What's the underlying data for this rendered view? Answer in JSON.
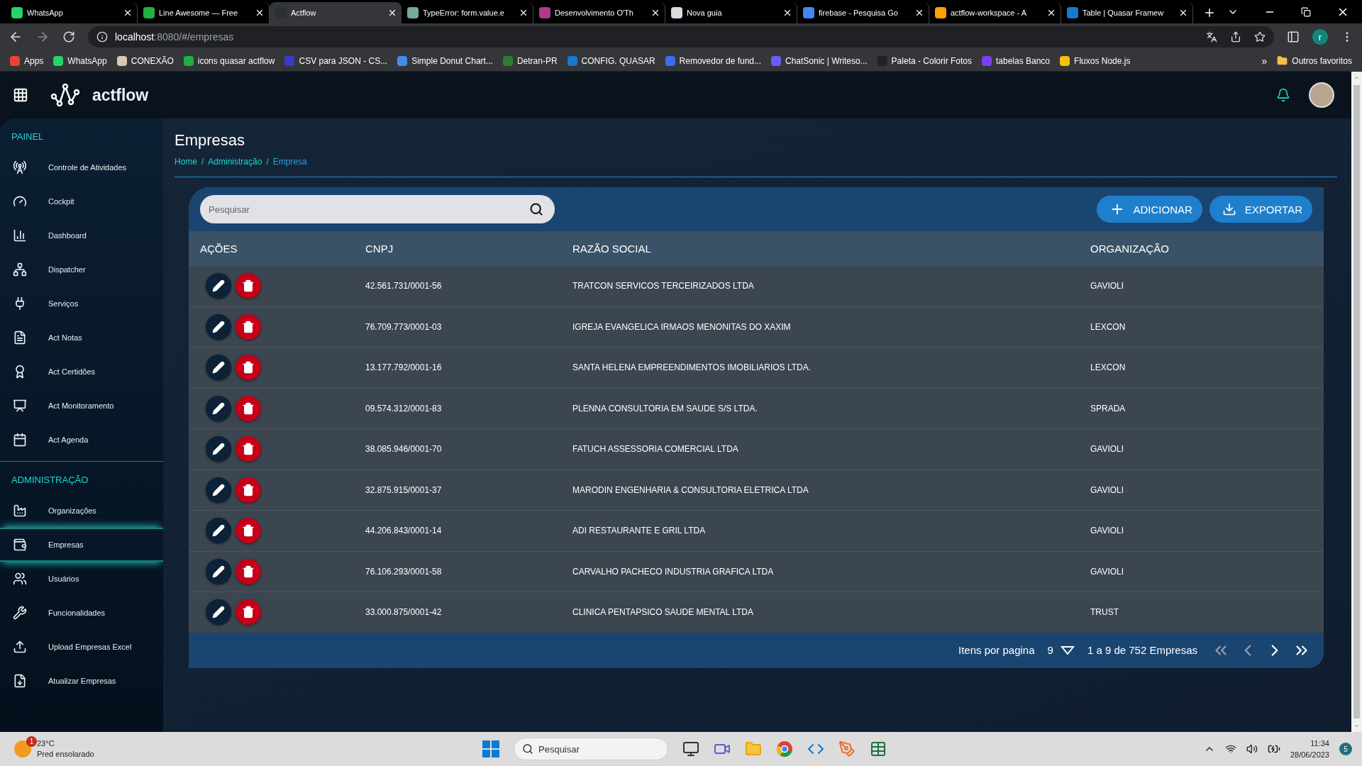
{
  "browser": {
    "tabs": [
      {
        "title": "WhatsApp",
        "selected": false,
        "color": "#25d366"
      },
      {
        "title": "Line Awesome — Free",
        "selected": false,
        "color": "#1fb141"
      },
      {
        "title": "Actflow",
        "selected": true,
        "color": "#2b2f36"
      },
      {
        "title": "TypeError: form.value.e",
        "selected": false,
        "color": "#74aa9c"
      },
      {
        "title": "Desenvolvimento O'Th",
        "selected": false,
        "color": "#b03a8c"
      },
      {
        "title": "Nova guia",
        "selected": false,
        "color": "#dadce0"
      },
      {
        "title": "firebase - Pesquisa Go",
        "selected": false,
        "color": "#4285f4"
      },
      {
        "title": "actflow-workspace - A",
        "selected": false,
        "color": "#ffa000"
      },
      {
        "title": "Table | Quasar Framew",
        "selected": false,
        "color": "#1976d2"
      }
    ],
    "address": {
      "host": "localhost",
      "path": ":8080/#/empresas"
    },
    "bookmarks": [
      {
        "label": "Apps",
        "color": "#ea4335"
      },
      {
        "label": "WhatsApp",
        "color": "#25d366"
      },
      {
        "label": "CONEXÃO",
        "color": "#d9c7b0"
      },
      {
        "label": "icons quasar actflow",
        "color": "#1fb141"
      },
      {
        "label": "CSV para JSON - CS...",
        "color": "#3a3ad0"
      },
      {
        "label": "Simple Donut Chart...",
        "color": "#3f8ef0"
      },
      {
        "label": "Detran-PR",
        "color": "#2e7d32"
      },
      {
        "label": "CONFIG. QUASAR",
        "color": "#1976d2"
      },
      {
        "label": "Removedor de fund...",
        "color": "#3b6df2"
      },
      {
        "label": "ChatSonic | Writeso...",
        "color": "#6b5cff"
      },
      {
        "label": "Paleta - Colorir Fotos",
        "color": "#222222"
      },
      {
        "label": "tabelas Banco",
        "color": "#7e3ff2"
      },
      {
        "label": "Fluxos Node.js",
        "color": "#f5c400"
      }
    ],
    "more_bookmarks": "»",
    "other_bookmarks": "Outros favoritos",
    "profile_initial": "r"
  },
  "app": {
    "brand": "actflow",
    "sidebar": [
      {
        "title": "PAINEL",
        "items": [
          {
            "label": "Controle de Atividades",
            "selected": false
          },
          {
            "label": "Cockpit",
            "selected": false
          },
          {
            "label": "Dashboard",
            "selected": false
          },
          {
            "label": "Dispatcher",
            "selected": false
          },
          {
            "label": "Serviços",
            "selected": false
          },
          {
            "label": "Act Notas",
            "selected": false
          },
          {
            "label": "Act Certidões",
            "selected": false
          },
          {
            "label": "Act Monitoramento",
            "selected": false
          },
          {
            "label": "Act Agenda",
            "selected": false
          }
        ]
      },
      {
        "title": "ADMINISTRAÇÃO",
        "items": [
          {
            "label": "Organizações",
            "selected": false
          },
          {
            "label": "Empresas",
            "selected": true
          },
          {
            "label": "Usuários",
            "selected": false
          },
          {
            "label": "Funcionalidades",
            "selected": false
          },
          {
            "label": "Upload Empresas Excel",
            "selected": false
          },
          {
            "label": "Atualizar Empresas",
            "selected": false
          }
        ]
      }
    ],
    "page_title": "Empresas",
    "breadcrumbs": [
      "Home",
      "Administração",
      "Empresa"
    ],
    "breadcrumb_separator": "/",
    "search": {
      "placeholder": "Pesquisar"
    },
    "buttons": [
      {
        "kind": "add",
        "label": "ADICIONAR"
      },
      {
        "kind": "export",
        "label": "EXPORTAR"
      }
    ],
    "table": {
      "columns": [
        "AÇÕES",
        "CNPJ",
        "RAZÃO SOCIAL",
        "ORGANIZAÇÃO"
      ],
      "rows": [
        {
          "cnpj": "42.561.731/0001-56",
          "razao_social": "TRATCON SERVICOS TERCEIRIZADOS LTDA",
          "organizacao": "GAVIOLI"
        },
        {
          "cnpj": "76.709.773/0001-03",
          "razao_social": "IGREJA EVANGELICA IRMAOS MENONITAS DO XAXIM",
          "organizacao": "LEXCON"
        },
        {
          "cnpj": "13.177.792/0001-16",
          "razao_social": "SANTA HELENA EMPREENDIMENTOS IMOBILIARIOS LTDA.",
          "organizacao": "LEXCON"
        },
        {
          "cnpj": "09.574.312/0001-83",
          "razao_social": "PLENNA CONSULTORIA EM SAUDE S/S LTDA.",
          "organizacao": "SPRADA"
        },
        {
          "cnpj": "38.085.946/0001-70",
          "razao_social": "FATUCH ASSESSORIA COMERCIAL LTDA",
          "organizacao": "GAVIOLI"
        },
        {
          "cnpj": "32.875.915/0001-37",
          "razao_social": "MARODIN ENGENHARIA & CONSULTORIA ELETRICA LTDA",
          "organizacao": "GAVIOLI"
        },
        {
          "cnpj": "44.206.843/0001-14",
          "razao_social": "ADI RESTAURANTE E GRIL LTDA",
          "organizacao": "GAVIOLI"
        },
        {
          "cnpj": "76.106.293/0001-58",
          "razao_social": "CARVALHO PACHECO INDUSTRIA GRAFICA LTDA",
          "organizacao": "GAVIOLI"
        },
        {
          "cnpj": "33.000.875/0001-42",
          "razao_social": "CLINICA PENTAPSICO SAUDE MENTAL LTDA",
          "organizacao": "TRUST"
        }
      ]
    },
    "pagination": {
      "label": "Itens por pagina",
      "per_page": "9",
      "range": "1 a 9 de 752 Empresas",
      "pager": [
        {
          "disabled": true
        },
        {
          "disabled": true
        },
        {
          "disabled": false
        },
        {
          "disabled": false
        }
      ]
    }
  },
  "taskbar": {
    "weather": {
      "badge": "1",
      "temperature": "23°C",
      "description": "Pred ensolarado"
    },
    "search": {
      "placeholder": "Pesquisar"
    },
    "time": "11:34",
    "date": "28/06/2023",
    "notifications": "5"
  }
}
